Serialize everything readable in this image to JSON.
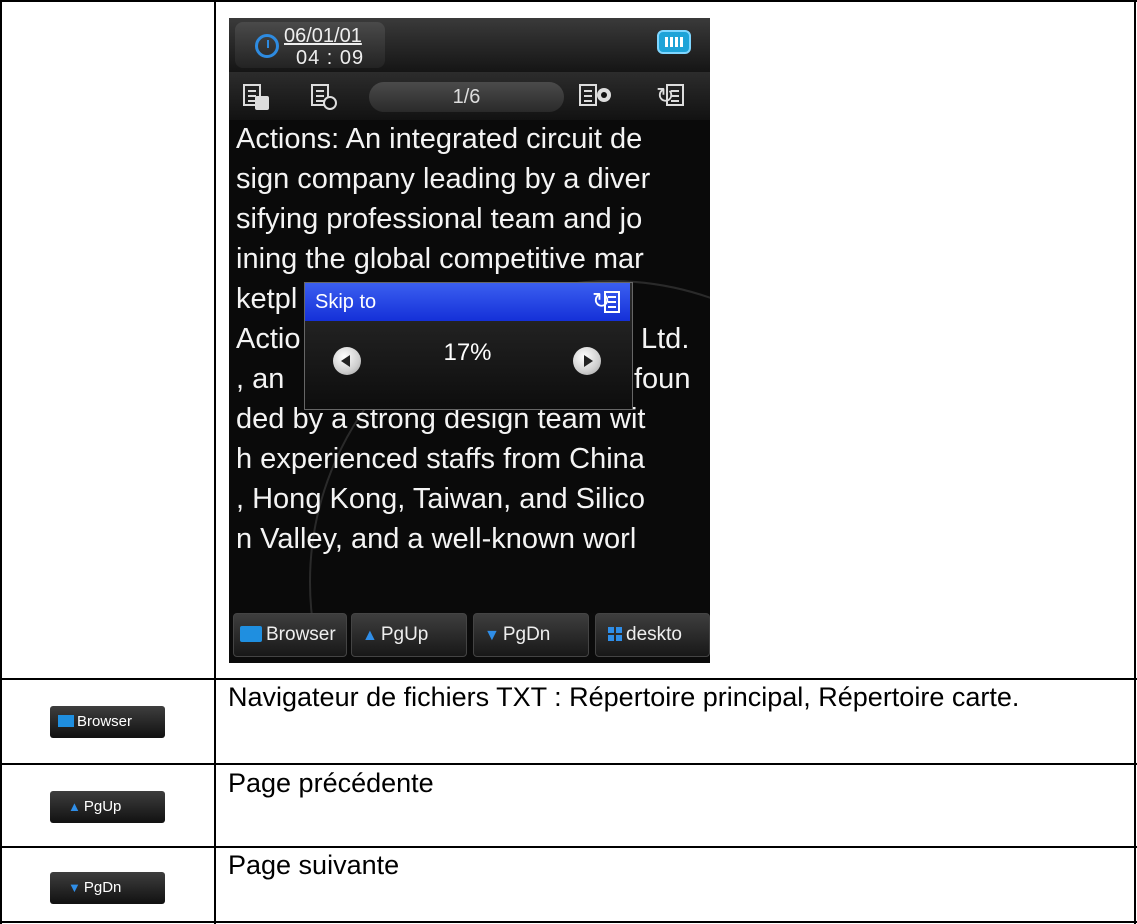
{
  "device": {
    "date": "06/01/01",
    "time": "04 : 09",
    "page_indicator": "1/6",
    "reader_lines": [
      "Actions: An integrated circuit de",
      "sign company leading by a diver",
      "sifying professional team and jo",
      "ining the global competitive mar",
      "ketpl",
      "Actio",
      ", an ",
      "ded by a strong design team wit",
      "h experienced staffs from China",
      ", Hong Kong, Taiwan, and Silico",
      "n Valley, and a well-known worl"
    ],
    "reader_fragments": {
      "ltd": "Ltd.",
      "foun": "foun"
    },
    "dialog": {
      "title": "Skip to",
      "percent": "17%"
    },
    "bottom_buttons": [
      "Browser",
      "PgUp",
      "PgDn",
      "deskto"
    ]
  },
  "rows": [
    {
      "button": "Browser",
      "text": "Navigateur de fichiers TXT : Répertoire principal, Répertoire carte."
    },
    {
      "button": "PgUp",
      "text": "Page précédente"
    },
    {
      "button": "PgDn",
      "text": "Page suivante"
    }
  ],
  "colors": {
    "accent_blue": "#2f8ee8",
    "dialog_title": "#1530d8",
    "battery": "#1ea3d8"
  }
}
